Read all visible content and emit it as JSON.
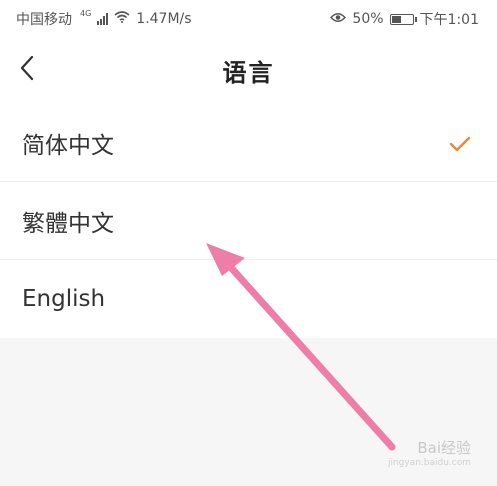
{
  "status_bar": {
    "carrier": "中国移动",
    "network_badge": "4G",
    "speed": "1.47M/s",
    "battery": "50%",
    "battery_level": 0.5,
    "time": "下午1:01"
  },
  "header": {
    "title": "语言",
    "back_icon": "chevron-left-icon"
  },
  "languages": [
    {
      "label": "简体中文",
      "selected": true
    },
    {
      "label": "繁體中文",
      "selected": false
    },
    {
      "label": "English",
      "selected": false
    }
  ],
  "colors": {
    "accent_check": "#e08a3c",
    "annotation_arrow": "#ee7ea8"
  },
  "watermark": {
    "main": "Bai经验",
    "sub": "jingyan.baidu.com"
  }
}
